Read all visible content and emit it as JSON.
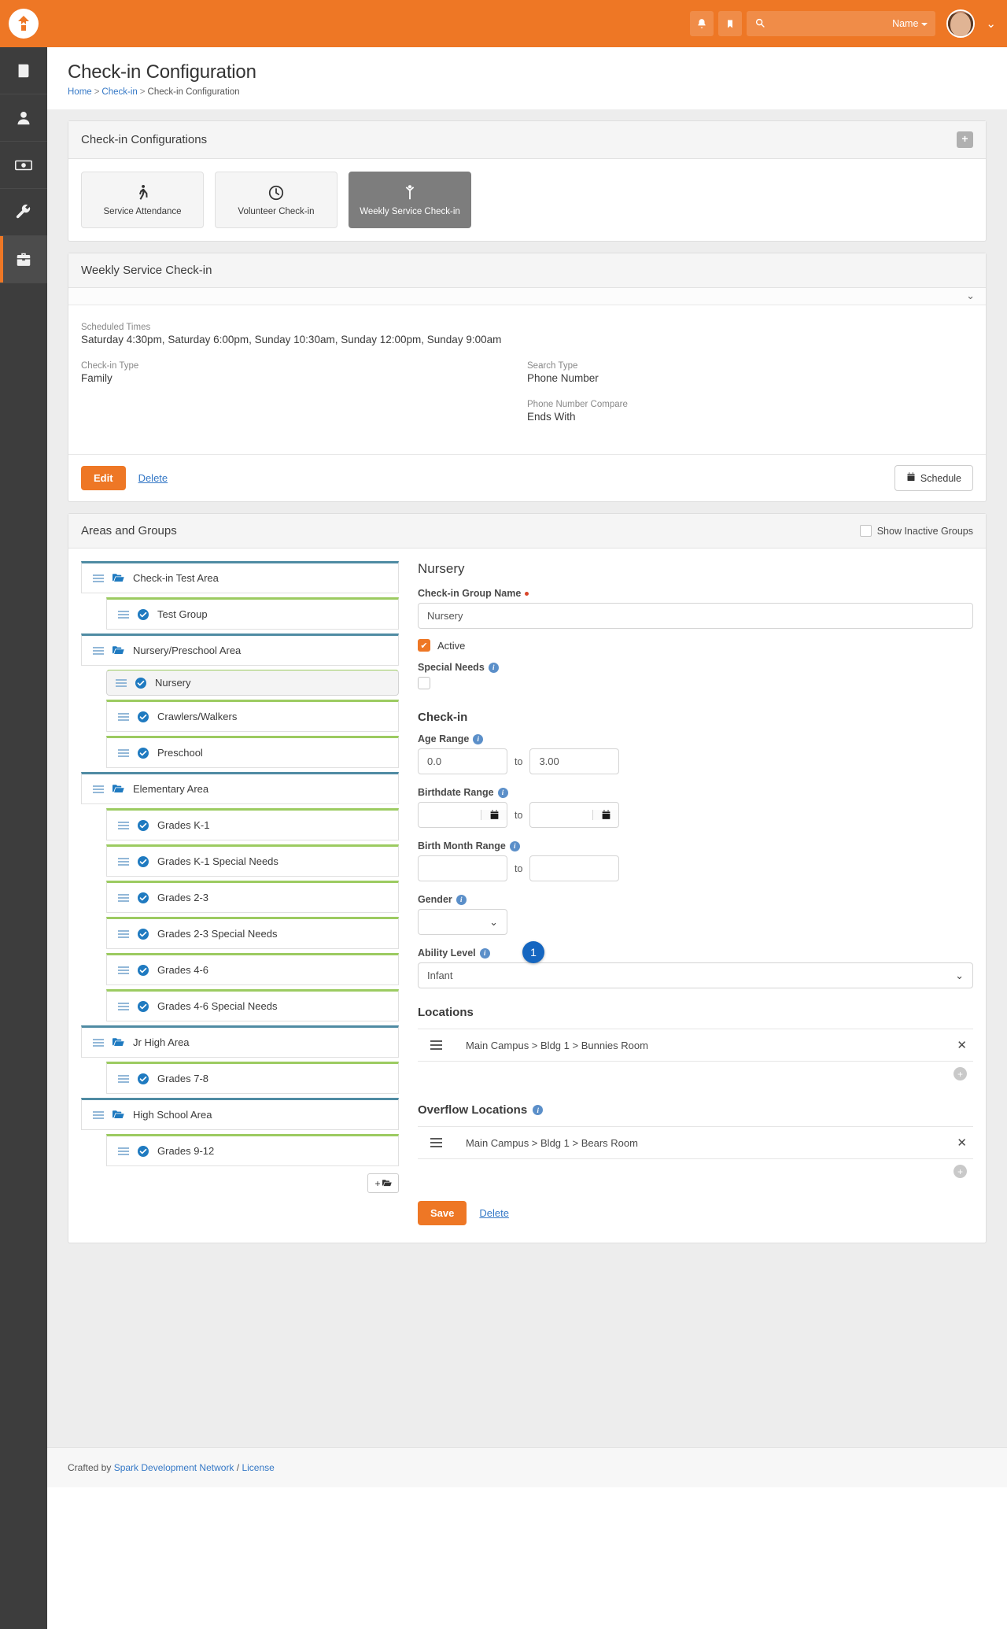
{
  "topbar": {
    "logo": "rock-logo-icon",
    "notifications_icon": "bell-icon",
    "bookmark_icon": "bookmark-icon",
    "search_icon": "search-icon",
    "search_value": "",
    "search_scope": "Name",
    "avatar": "user-avatar",
    "user_chevron": "chevron-down-icon",
    "accent": "#ee7725"
  },
  "sidebar": {
    "items": [
      {
        "name": "content-icon",
        "active": false
      },
      {
        "name": "person-icon",
        "active": false
      },
      {
        "name": "finance-icon",
        "active": false
      },
      {
        "name": "tools-icon",
        "active": false
      },
      {
        "name": "admin-toolbox-icon",
        "active": true
      }
    ]
  },
  "page": {
    "title": "Check-in Configuration",
    "breadcrumb": [
      {
        "label": "Home",
        "link": true
      },
      {
        "label": "Check-in",
        "link": true
      },
      {
        "label": "Check-in Configuration",
        "link": false
      }
    ]
  },
  "configurations_panel": {
    "title": "Check-in Configurations",
    "add_button": "+",
    "cards": [
      {
        "label": "Service Attendance",
        "icon": "walking-icon",
        "selected": false
      },
      {
        "label": "Volunteer Check-in",
        "icon": "clock-icon",
        "selected": false
      },
      {
        "label": "Weekly Service Check-in",
        "icon": "child-icon",
        "selected": true
      }
    ]
  },
  "detail_panel": {
    "title": "Weekly Service Check-in",
    "collapse_icon": "chevron-down-icon",
    "fields": [
      {
        "label": "Scheduled Times",
        "value": "Saturday 4:30pm, Saturday 6:00pm, Sunday 10:30am, Sunday 12:00pm, Sunday 9:00am"
      },
      {
        "label": "Check-in Type",
        "value": "Family"
      },
      {
        "label": "Search Type",
        "value": "Phone Number"
      },
      {
        "label": "Phone Number Compare",
        "value": "Ends With"
      }
    ],
    "edit_label": "Edit",
    "delete_label": "Delete",
    "schedule_label": "Schedule",
    "schedule_icon": "calendar-icon"
  },
  "areas_panel": {
    "title": "Areas and Groups",
    "show_inactive_label": "Show Inactive Groups",
    "show_inactive_checked": false,
    "tree": [
      {
        "label": "Check-in Test Area",
        "type": "area",
        "icon": "folder-open-icon",
        "selected": false
      },
      {
        "label": "Test Group",
        "type": "group",
        "icon": "check-circle-icon",
        "selected": false
      },
      {
        "label": "Nursery/Preschool Area",
        "type": "area",
        "icon": "folder-open-icon",
        "selected": false
      },
      {
        "label": "Nursery",
        "type": "group",
        "icon": "check-circle-icon",
        "selected": true
      },
      {
        "label": "Crawlers/Walkers",
        "type": "group",
        "icon": "check-circle-icon",
        "selected": false
      },
      {
        "label": "Preschool",
        "type": "group",
        "icon": "check-circle-icon",
        "selected": false
      },
      {
        "label": "Elementary Area",
        "type": "area",
        "icon": "folder-open-icon",
        "selected": false
      },
      {
        "label": "Grades K-1",
        "type": "group",
        "icon": "check-circle-icon",
        "selected": false
      },
      {
        "label": "Grades K-1 Special Needs",
        "type": "group",
        "icon": "check-circle-icon",
        "selected": false
      },
      {
        "label": "Grades 2-3",
        "type": "group",
        "icon": "check-circle-icon",
        "selected": false
      },
      {
        "label": "Grades 2-3 Special Needs",
        "type": "group",
        "icon": "check-circle-icon",
        "selected": false
      },
      {
        "label": "Grades 4-6",
        "type": "group",
        "icon": "check-circle-icon",
        "selected": false
      },
      {
        "label": "Grades 4-6 Special Needs",
        "type": "group",
        "icon": "check-circle-icon",
        "selected": false
      },
      {
        "label": "Jr High Area",
        "type": "area",
        "icon": "folder-open-icon",
        "selected": false
      },
      {
        "label": "Grades 7-8",
        "type": "group",
        "icon": "check-circle-icon",
        "selected": false
      },
      {
        "label": "High School Area",
        "type": "area",
        "icon": "folder-open-icon",
        "selected": false
      },
      {
        "label": "Grades 9-12",
        "type": "group",
        "icon": "check-circle-icon",
        "selected": false
      }
    ],
    "add_area_button": "add-area-icon"
  },
  "group_form": {
    "heading": "Nursery",
    "name_label": "Check-in Group Name",
    "name_value": "Nursery",
    "active_label": "Active",
    "active_checked": true,
    "special_needs_label": "Special Needs",
    "special_needs_checked": false,
    "checkin_heading": "Check-in",
    "age_range_label": "Age Range",
    "age_min": "0.0",
    "age_max": "3.00",
    "birthdate_label": "Birthdate Range",
    "birthdate_min": "",
    "birthdate_max": "",
    "birth_month_label": "Birth Month Range",
    "birth_month_min": "",
    "birth_month_max": "",
    "gender_label": "Gender",
    "gender_value": "",
    "ability_label": "Ability Level",
    "ability_value": "Infant",
    "to_label": "to",
    "annotation_badge": "1",
    "locations_heading": "Locations",
    "locations": [
      {
        "text": "Main Campus > Bldg 1 > Bunnies Room"
      }
    ],
    "overflow_heading": "Overflow Locations",
    "overflow_locations": [
      {
        "text": "Main Campus > Bldg 1 > Bears Room"
      }
    ],
    "save_label": "Save",
    "delete_label": "Delete"
  },
  "footer": {
    "prefix": "Crafted by",
    "link1": "Spark Development Network",
    "separator": "/",
    "link2": "License"
  }
}
